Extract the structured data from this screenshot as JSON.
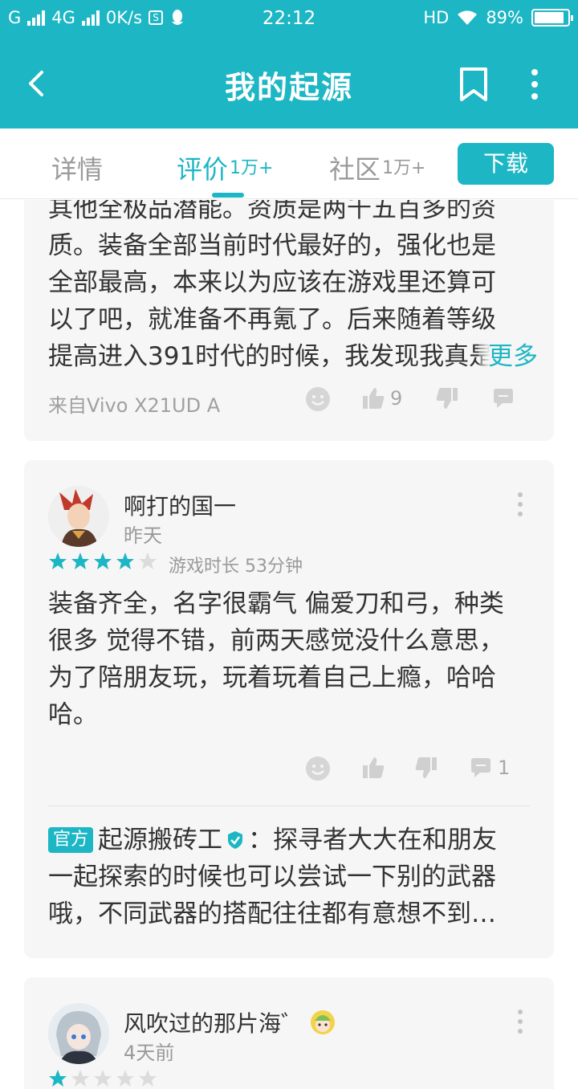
{
  "status_bar": {
    "carrier1": "G",
    "carrier2": "4G",
    "speed": "0K/s",
    "time": "22:12",
    "hd": "HD",
    "battery_percent": "89%",
    "battery_level": 0.89
  },
  "app_bar": {
    "title": "我的起源"
  },
  "tabs": [
    {
      "label": "详情",
      "count": ""
    },
    {
      "label": "评价",
      "count": "1万+"
    },
    {
      "label": "社区",
      "count": "1万+"
    }
  ],
  "download_label": "下载",
  "accent_color": "#1db6c4",
  "reviews": [
    {
      "text_lines": [
        "其他全极品潜能。资质是两千五百多的资",
        "质。装备全部当前时代最好的，强化也是",
        "全部最高，本来以为应该在游戏里还算可",
        "以了吧，就准备不再氪了。后来随着等级",
        "提高进入391时代的时候，我发现我真是"
      ],
      "more_label": "更多",
      "source": "来自Vivo X21UD A",
      "like_count": "9",
      "comment_count": ""
    },
    {
      "username": "啊打的国一",
      "time": "昨天",
      "rating": 4,
      "max_rating": 5,
      "playtime": "游戏时长 53分钟",
      "text_lines": [
        "装备齐全，名字很霸气 偏爱刀和弓，种类",
        "很多 觉得不错，前两天感觉没什么意思，",
        "为了陪朋友玩，玩着玩着自己上瘾，哈哈",
        "哈。"
      ],
      "like_count": "",
      "comment_count": "1",
      "official_reply": {
        "badge": "官方",
        "name": "起源搬砖工",
        "line1": "：探寻者大大在和朋友",
        "line2": "一起探索的时候也可以尝试一下别的武器",
        "line3": "哦，不同武器的搭配往往都有意想不到…"
      }
    },
    {
      "username": "风吹过的那片海゛",
      "time": "4天前",
      "rating": 1,
      "max_rating": 5
    }
  ]
}
